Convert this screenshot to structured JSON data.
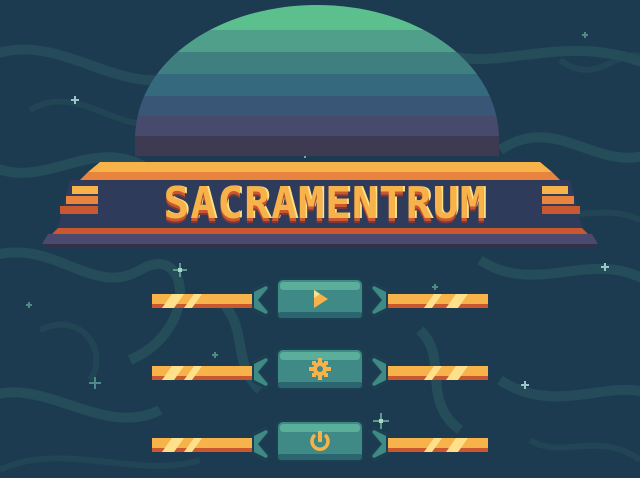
{
  "game": {
    "title": "SACRAMENTRUM"
  },
  "menu": {
    "buttons": [
      {
        "label": "Play",
        "icon": "play-icon"
      },
      {
        "label": "Settings",
        "icon": "gear-icon"
      },
      {
        "label": "Quit",
        "icon": "power-icon"
      }
    ]
  },
  "colors": {
    "background": "#1c3a4e",
    "nebula": "#2a5a5e",
    "button_fill": "#3f8a86",
    "button_border": "#1d4050",
    "accent_orange": "#f7b34a",
    "accent_deep": "#c9572f",
    "banner_purple": "#4a4a6e"
  }
}
